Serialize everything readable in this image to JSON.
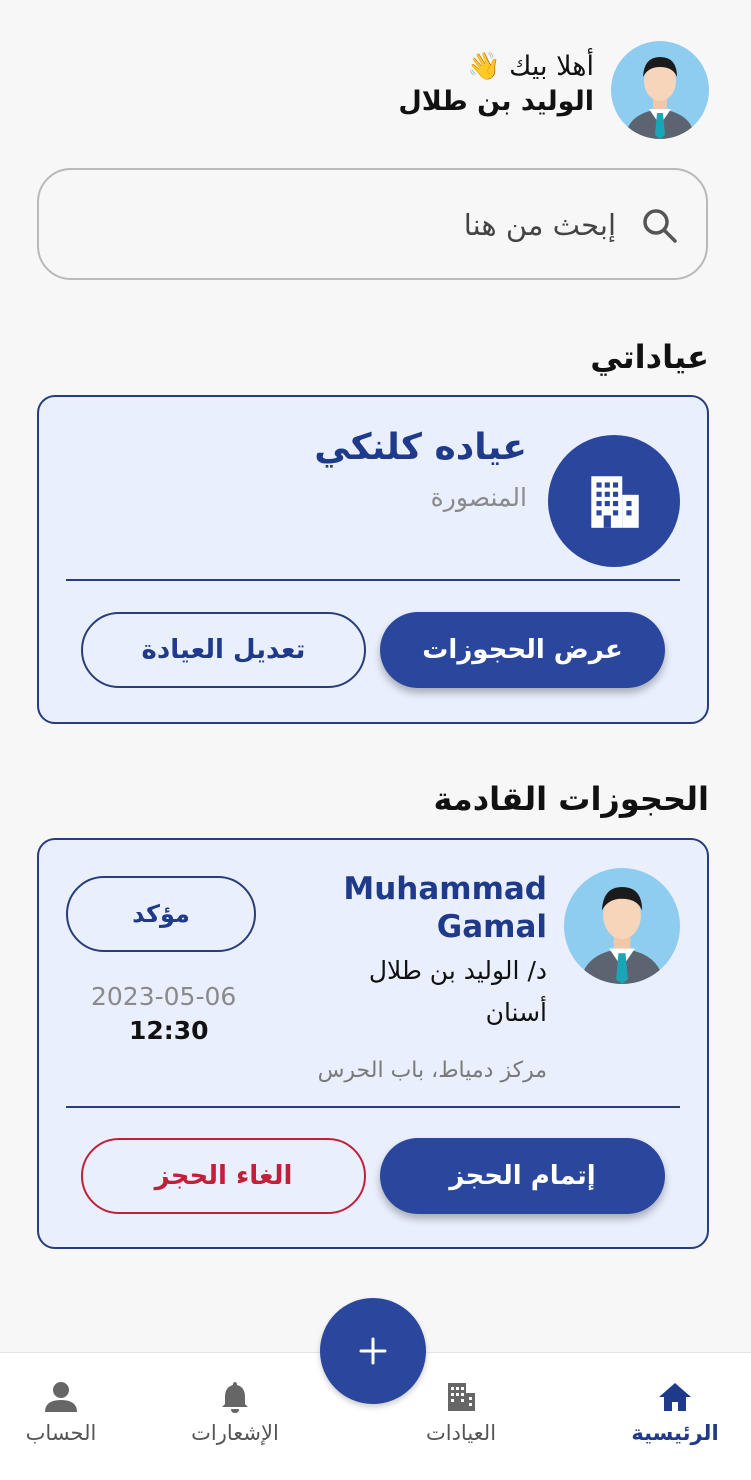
{
  "header": {
    "greeting": "أهلا بيك 👋",
    "user_name": "الوليد بن طلال"
  },
  "search": {
    "placeholder": "إبحث من هنا",
    "value": ""
  },
  "my_clinics": {
    "title": "عياداتي",
    "clinic": {
      "name": "عياده كلنكي",
      "city": "المنصورة",
      "view_bookings_label": "عرض الحجوزات",
      "edit_clinic_label": "تعديل العيادة"
    }
  },
  "upcoming": {
    "title": "الحجوزات القادمة",
    "booking": {
      "patient_name_line1": "Muhammad",
      "patient_name_line2": "Gamal",
      "doctor": "د/ الوليد بن طلال",
      "specialty": "أسنان",
      "address": "مركز دمياط، باب الحرس",
      "status": "مؤكد",
      "date": "2023-05-06",
      "time": "12:30",
      "complete_label": "إتمام الحجز",
      "cancel_label": "الغاء الحجز"
    }
  },
  "bottom_nav": {
    "items": [
      {
        "label": "الرئيسية",
        "icon": "home-icon",
        "active": true
      },
      {
        "label": "العيادات",
        "icon": "building-icon",
        "active": false
      },
      {
        "label": "الإشعارات",
        "icon": "bell-icon",
        "active": false
      },
      {
        "label": "الحساب",
        "icon": "person-icon",
        "active": false
      }
    ],
    "fab_icon": "plus-icon"
  },
  "colors": {
    "primary": "#2a479d",
    "card_bg": "#e9effd",
    "danger": "#c0203a"
  }
}
